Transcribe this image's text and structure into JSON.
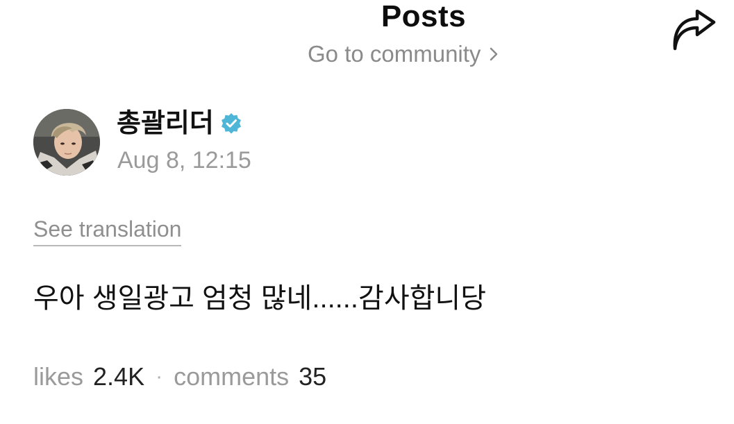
{
  "header": {
    "title": "Posts",
    "community_link": "Go to community",
    "share_icon": "share-forward-icon"
  },
  "post": {
    "author": {
      "name": "총괄리더",
      "verified": true,
      "badge_color": "#4fb6d8"
    },
    "timestamp": "Aug 8, 12:15",
    "see_translation": "See translation",
    "body": "우아 생일광고 엄청 많네......감사합니당"
  },
  "stats": {
    "likes_label": "likes",
    "likes_value": "2.4K",
    "separator": "·",
    "comments_label": "comments",
    "comments_value": "35"
  }
}
